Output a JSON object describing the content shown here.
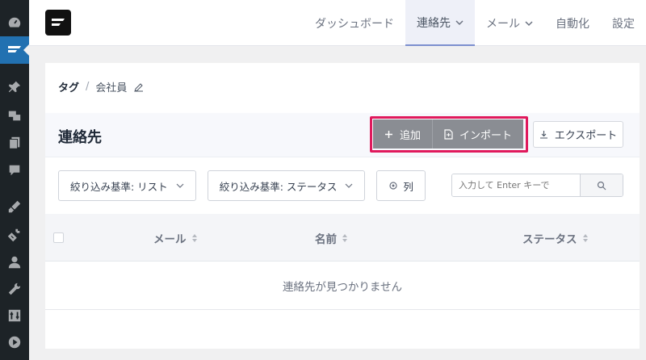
{
  "sidebar": {
    "icons": [
      "dashboard-icon",
      "fluent-crm-icon",
      "pin-icon",
      "media-icon",
      "pages-icon",
      "comments-icon",
      "appearance-icon",
      "plugins-icon",
      "users-icon",
      "tools-icon",
      "settings-icon",
      "play-icon"
    ],
    "active": "fluent-crm-icon",
    "accent_color": "#2271b1"
  },
  "topnav": {
    "items": [
      {
        "label": "ダッシュボード",
        "dropdown": false
      },
      {
        "label": "連絡先",
        "dropdown": true,
        "active": true
      },
      {
        "label": "メール",
        "dropdown": true
      },
      {
        "label": "自動化",
        "dropdown": false
      },
      {
        "label": "設定",
        "dropdown": false
      }
    ]
  },
  "breadcrumb": {
    "root": "タグ",
    "sep": "/",
    "current": "会社員"
  },
  "header": {
    "title": "連絡先",
    "add_label": "追加",
    "import_label": "インポート",
    "export_label": "エクスポート",
    "highlight_color": "#e0195c"
  },
  "filters": {
    "list_label": "絞り込み基準: リスト",
    "status_label": "絞り込み基準: ステータス",
    "columns_label": "列",
    "search_placeholder": "入力して Enter キーで"
  },
  "table": {
    "columns": [
      "メール",
      "名前",
      "ステータス"
    ],
    "empty_text": "連絡先が見つかりません"
  }
}
